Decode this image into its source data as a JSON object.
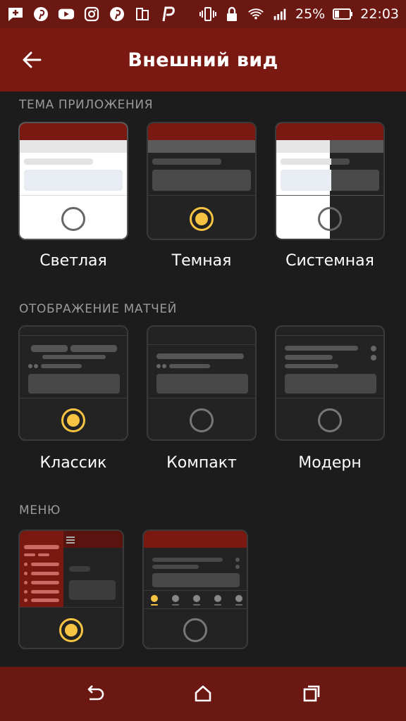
{
  "status_bar": {
    "battery_percent": "25%",
    "time": "22:03",
    "icons": [
      "message-plus-icon",
      "pinterest-icon",
      "youtube-icon",
      "instagram-icon",
      "pinterest-icon",
      "sim-icon",
      "p-app-icon",
      "vibrate-icon",
      "lock-icon",
      "wifi-icon",
      "signal-icon",
      "battery-icon"
    ]
  },
  "header": {
    "title": "Внешний вид",
    "back_icon": "arrow-left-icon"
  },
  "theme_section": {
    "label": "ТЕМА ПРИЛОЖЕНИЯ",
    "options": [
      {
        "label": "Светлая",
        "selected": false
      },
      {
        "label": "Темная",
        "selected": true
      },
      {
        "label": "Системная",
        "selected": false
      }
    ]
  },
  "matches_section": {
    "label": "ОТОБРАЖЕНИЕ МАТЧЕЙ",
    "options": [
      {
        "label": "Классик",
        "selected": true
      },
      {
        "label": "Компакт",
        "selected": false
      },
      {
        "label": "Модерн",
        "selected": false
      }
    ]
  },
  "menu_section": {
    "label": "МЕНЮ",
    "options": [
      {
        "label": "",
        "selected": true
      },
      {
        "label": "",
        "selected": false
      }
    ]
  },
  "nav_bar": {
    "icons": [
      "back-icon",
      "home-icon",
      "recents-icon"
    ]
  },
  "colors": {
    "brand": "#7a1912",
    "accent": "#f6c343",
    "background": "#1c1c1c"
  }
}
